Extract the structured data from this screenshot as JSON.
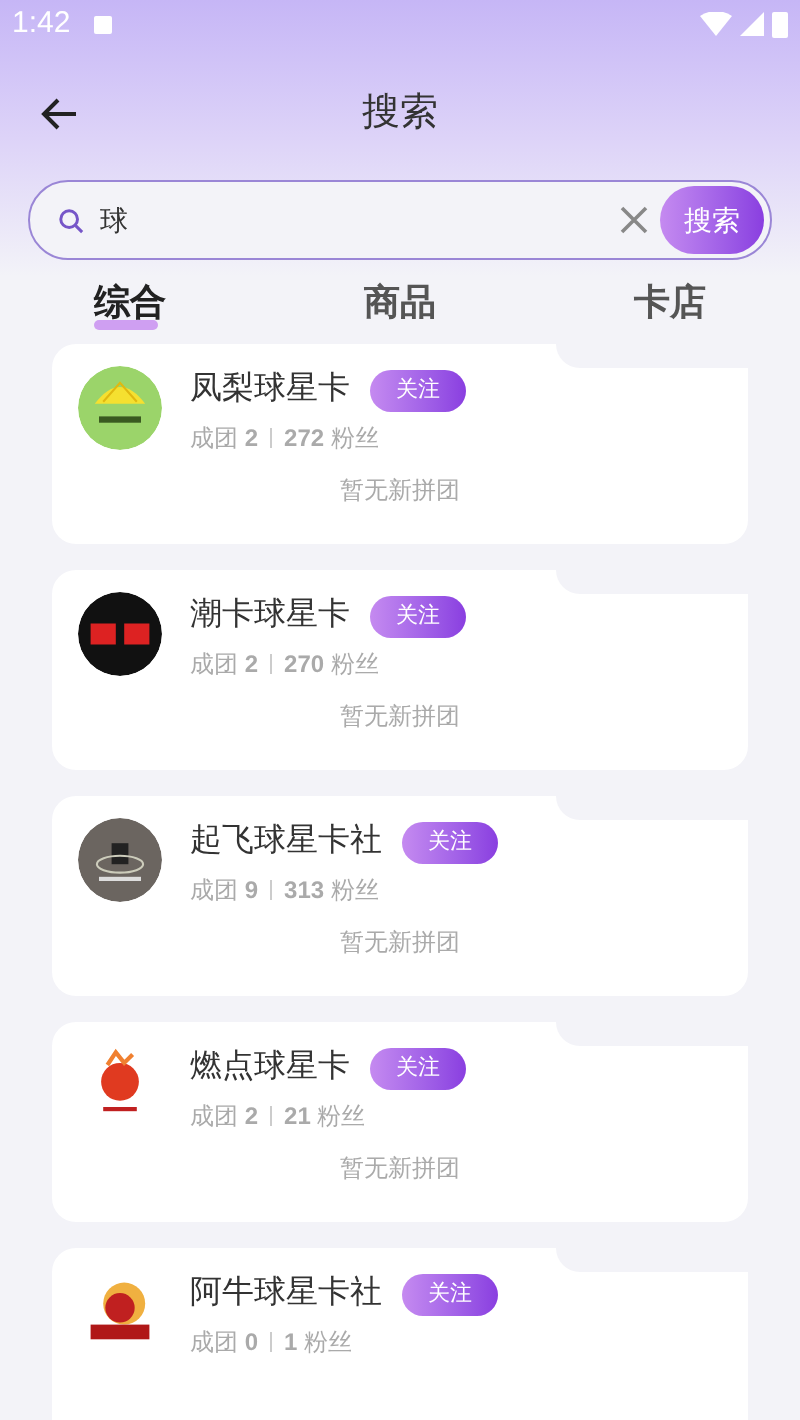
{
  "status_bar": {
    "time": "1:42"
  },
  "header": {
    "title": "搜索"
  },
  "search": {
    "value": "球",
    "button": "搜索"
  },
  "tabs": [
    {
      "label": "综合",
      "selected": true
    },
    {
      "label": "商品",
      "selected": false
    },
    {
      "label": "卡店",
      "selected": false
    }
  ],
  "shops": [
    {
      "name": "凤梨球星卡",
      "follow": "关注",
      "groups_label": "成团",
      "groups": "2",
      "fans": "272",
      "fans_label": "粉丝",
      "note": "暂无新拼团"
    },
    {
      "name": "潮卡球星卡",
      "follow": "关注",
      "groups_label": "成团",
      "groups": "2",
      "fans": "270",
      "fans_label": "粉丝",
      "note": "暂无新拼团"
    },
    {
      "name": "起飞球星卡社",
      "follow": "关注",
      "groups_label": "成团",
      "groups": "9",
      "fans": "313",
      "fans_label": "粉丝",
      "note": "暂无新拼团"
    },
    {
      "name": "燃点球星卡",
      "follow": "关注",
      "groups_label": "成团",
      "groups": "2",
      "fans": "21",
      "fans_label": "粉丝",
      "note": "暂无新拼团"
    },
    {
      "name": "阿牛球星卡社",
      "follow": "关注",
      "groups_label": "成团",
      "groups": "0",
      "fans": "1",
      "fans_label": "粉丝"
    }
  ]
}
